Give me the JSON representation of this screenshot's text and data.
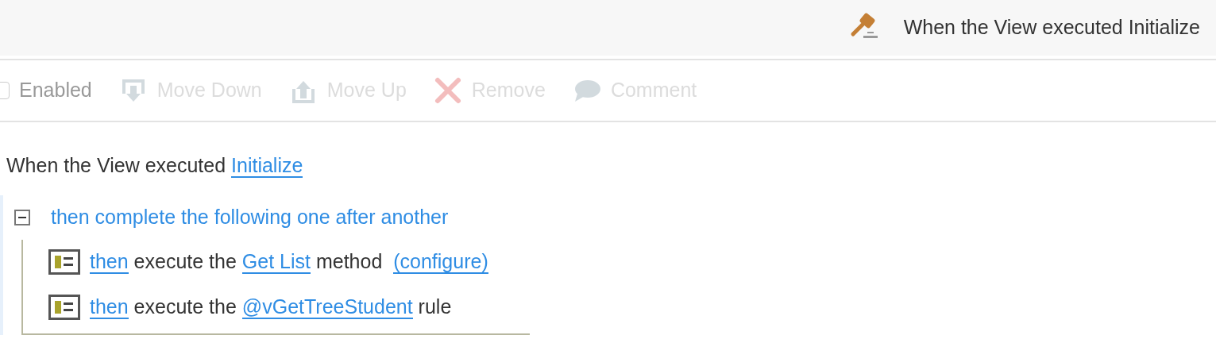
{
  "header": {
    "title": "When the View executed Initialize"
  },
  "toolbar": [
    {
      "kind": "checkbox",
      "label": "Enabled",
      "checked": false,
      "disabled": false
    },
    {
      "kind": "move-down",
      "label": "Move Down",
      "disabled": true
    },
    {
      "kind": "move-up",
      "label": "Move Up",
      "disabled": true
    },
    {
      "kind": "remove",
      "label": "Remove",
      "disabled": true
    },
    {
      "kind": "comment",
      "label": "Comment",
      "disabled": true
    }
  ],
  "event": [
    {
      "kind": "text",
      "text": "When the View executed "
    },
    {
      "kind": "link",
      "text": "Initialize"
    }
  ],
  "group": {
    "label": "then complete the following one after another",
    "expanded": true,
    "actions": [
      {
        "parts": [
          {
            "kind": "link",
            "text": "then"
          },
          {
            "kind": "text",
            "text": " execute the "
          },
          {
            "kind": "link",
            "text": "Get List"
          },
          {
            "kind": "text",
            "text": " method  "
          },
          {
            "kind": "link",
            "text": "(configure)"
          }
        ]
      },
      {
        "parts": [
          {
            "kind": "link",
            "text": "then"
          },
          {
            "kind": "text",
            "text": " execute the "
          },
          {
            "kind": "link",
            "text": "@vGetTreeStudent"
          },
          {
            "kind": "text",
            "text": " rule"
          }
        ]
      }
    ]
  }
}
